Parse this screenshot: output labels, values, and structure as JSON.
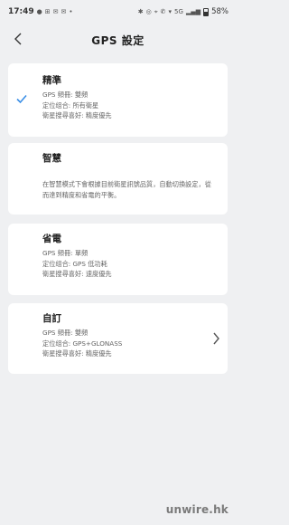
{
  "status_bar": {
    "time": "17:49",
    "left_icons": [
      "●",
      "⊞",
      "✉",
      "✉",
      "•"
    ],
    "right_icons": [
      "✱",
      "◎",
      "⌖",
      "✆",
      "▾",
      "5G",
      "▂▄▆"
    ],
    "battery": "58%"
  },
  "header": {
    "title": "GPS 設定",
    "back_icon": "chevron-left-icon"
  },
  "options": [
    {
      "title": "精準",
      "selected": true,
      "lines": [
        "GPS 頻冊: 雙頻",
        "定位组合: 所有衛星",
        "衛星搜尋喜好: 精度優先"
      ]
    },
    {
      "title": "智慧",
      "selected": false,
      "description": "在智慧模式下會根據目前衛星訊號品質，自動切換設定，從而達到精度和省電的平衡。"
    },
    {
      "title": "省電",
      "selected": false,
      "lines": [
        "GPS 頻冊: 單頻",
        "定位组合: GPS 低功耗",
        "衛星搜尋喜好: 速度優先"
      ]
    },
    {
      "title": "自訂",
      "selected": false,
      "has_chevron": true,
      "lines": [
        "GPS 頻冊: 雙頻",
        "定位组合: GPS+GLONASS",
        "衛星搜尋喜好: 精度優先"
      ]
    }
  ],
  "colors": {
    "accent": "#3a8ee6",
    "background": "#eff0f2",
    "card": "#ffffff"
  },
  "watermark": "unwire.hk"
}
